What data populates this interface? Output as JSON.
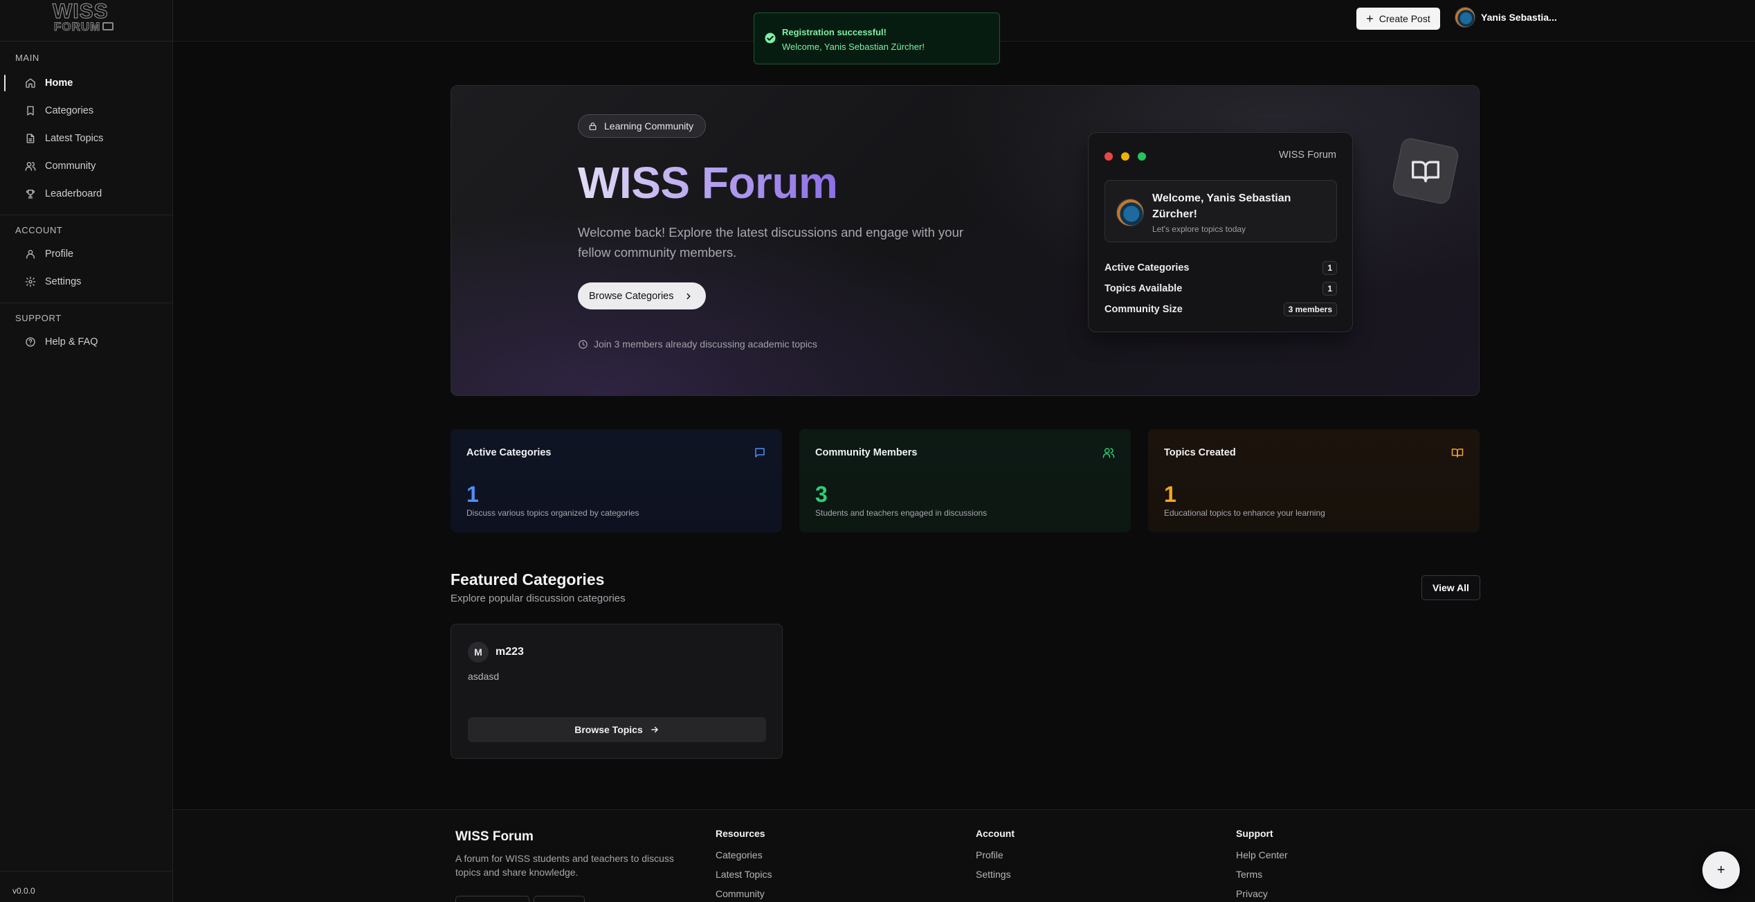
{
  "brand": {
    "logo_line1": "WISS",
    "logo_line2": "FORUM"
  },
  "sidebar": {
    "sections": [
      {
        "title": "MAIN",
        "items": [
          {
            "label": "Home",
            "icon": "home-icon",
            "active": true
          },
          {
            "label": "Categories",
            "icon": "bookmark-icon"
          },
          {
            "label": "Latest Topics",
            "icon": "document-icon"
          },
          {
            "label": "Community",
            "icon": "users-icon"
          },
          {
            "label": "Leaderboard",
            "icon": "trophy-icon"
          }
        ]
      },
      {
        "title": "ACCOUNT",
        "items": [
          {
            "label": "Profile",
            "icon": "user-icon"
          },
          {
            "label": "Settings",
            "icon": "gear-icon"
          }
        ]
      },
      {
        "title": "SUPPORT",
        "items": [
          {
            "label": "Help & FAQ",
            "icon": "help-circle-icon"
          }
        ]
      }
    ],
    "version": "v0.0.0"
  },
  "toast": {
    "title": "Registration successful!",
    "message": "Welcome, Yanis Sebastian Zürcher!",
    "color": "#7ef0a8"
  },
  "header": {
    "create_post_label": "Create Post",
    "user_name": "Yanis Sebastia..."
  },
  "hero": {
    "badge": "Learning Community",
    "title": "WISS Forum",
    "subtitle": "Welcome back! Explore the latest discussions and engage with your fellow community members.",
    "cta_label": "Browse Categories",
    "join_text": "Join 3 members already discussing academic topics",
    "preview": {
      "window_title": "WISS Forum",
      "welcome_name": "Welcome, Yanis Sebastian Zürcher!",
      "welcome_sub": "Let's explore topics today",
      "stats": [
        {
          "label": "Active Categories",
          "value": "1"
        },
        {
          "label": "Topics Available",
          "value": "1"
        },
        {
          "label": "Community Size",
          "value": "3 members"
        }
      ]
    }
  },
  "stats": [
    {
      "title": "Active Categories",
      "value": "1",
      "description": "Discuss various topics organized by categories",
      "color": "#4f8ef7",
      "icon": "message-square-icon"
    },
    {
      "title": "Community Members",
      "value": "3",
      "description": "Students and teachers engaged in discussions",
      "color": "#2ecf75",
      "icon": "users-icon"
    },
    {
      "title": "Topics Created",
      "value": "1",
      "description": "Educational topics to enhance your learning",
      "color": "#f5a524",
      "icon": "book-open-icon"
    }
  ],
  "featured": {
    "title": "Featured Categories",
    "subtitle": "Explore popular discussion categories",
    "view_all_label": "View All",
    "categories": [
      {
        "initial": "M",
        "name": "m223",
        "description": "asdasd",
        "button_label": "Browse Topics"
      }
    ]
  },
  "footer": {
    "brand": "WISS Forum",
    "description": "A forum for WISS students and teachers to discuss topics and share knowledge.",
    "columns": [
      {
        "title": "Resources",
        "links": [
          "Categories",
          "Latest Topics",
          "Community"
        ]
      },
      {
        "title": "Account",
        "links": [
          "Profile",
          "Settings"
        ]
      },
      {
        "title": "Support",
        "links": [
          "Help Center",
          "Terms",
          "Privacy"
        ]
      }
    ]
  },
  "fab_label": "+"
}
